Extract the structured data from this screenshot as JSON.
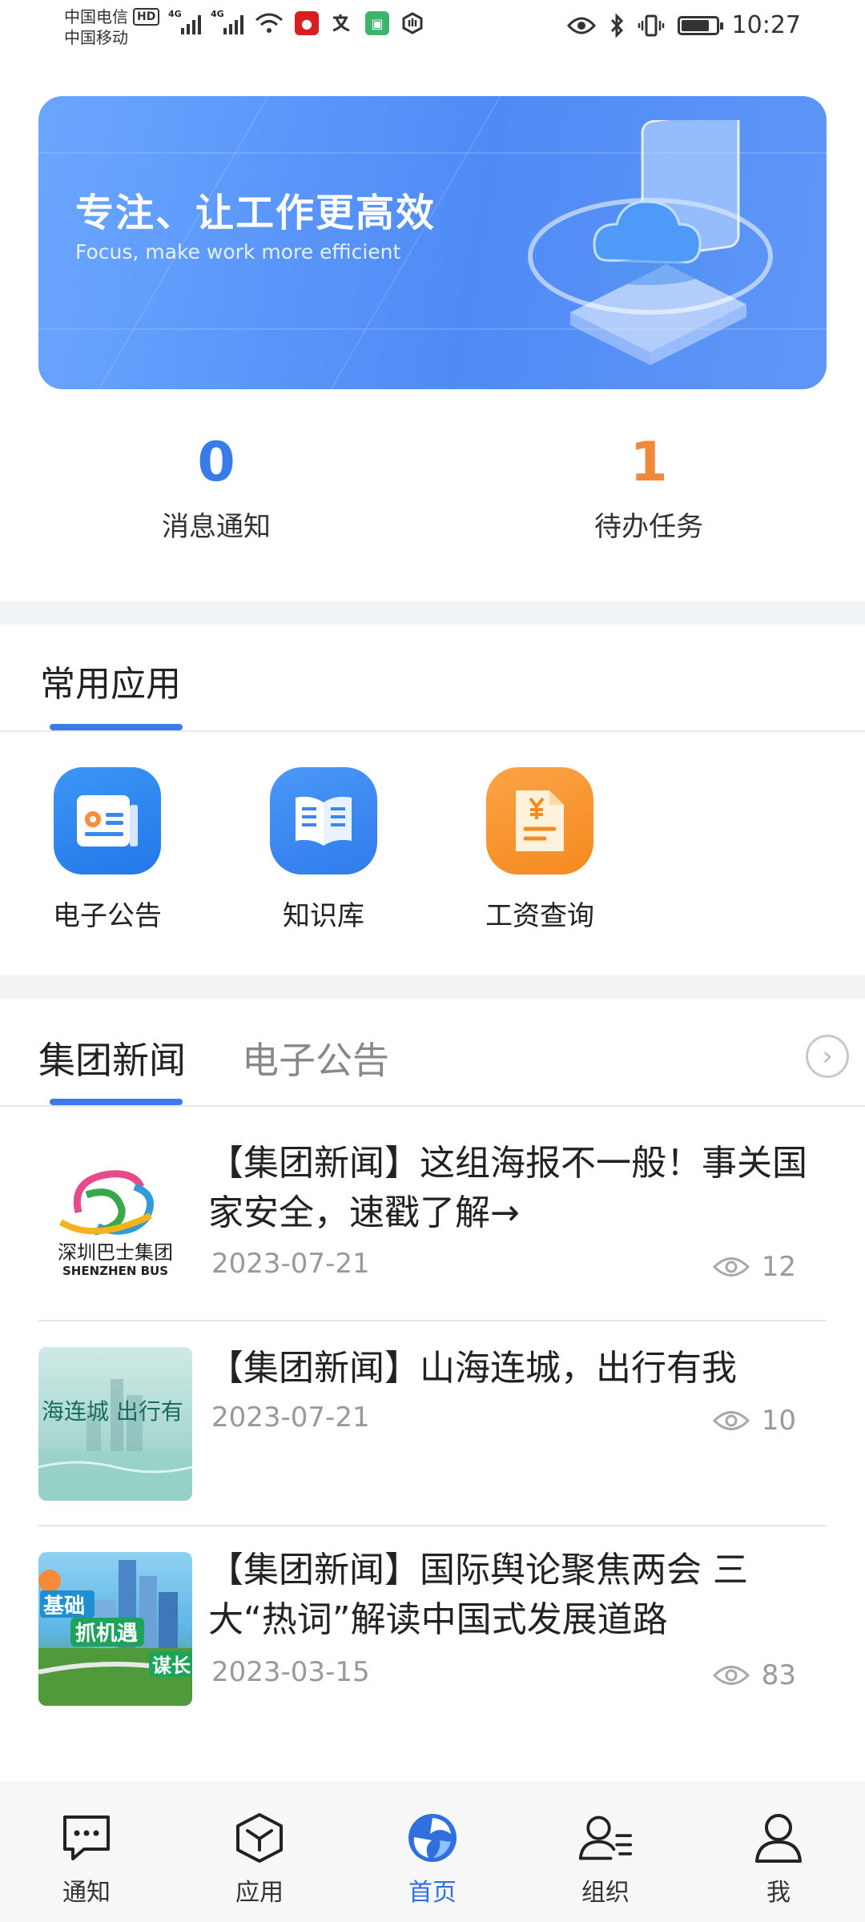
{
  "status_bar": {
    "carrier_1": "中国电信",
    "carrier_1_badge": "HD",
    "carrier_2": "中国移动",
    "network_tag": "4G",
    "time": "10:27"
  },
  "banner": {
    "title": "专注、让工作更高效",
    "subtitle": "Focus, make work more efficient"
  },
  "stats": [
    {
      "value": "0",
      "label": "消息通知",
      "color": "#3a7bea"
    },
    {
      "value": "1",
      "label": "待办任务",
      "color": "#f0893a"
    }
  ],
  "common_apps": {
    "title": "常用应用",
    "items": [
      {
        "label": "电子公告",
        "icon": "announcement-icon",
        "color": "#2f86f0"
      },
      {
        "label": "知识库",
        "icon": "book-icon",
        "color": "#3a86f2"
      },
      {
        "label": "工资查询",
        "icon": "salary-document-icon",
        "color": "#f79630"
      }
    ]
  },
  "news_tabs": {
    "tabs": [
      "集团新闻",
      "电子公告"
    ],
    "active": "集团新闻"
  },
  "news": [
    {
      "title": "【集团新闻】这组海报不一般！事关国家安全，速戳了解→",
      "date": "2023-07-21",
      "views": "12",
      "thumb_text": "深圳巴士集团",
      "thumb_subtext": "SHENZHEN BUS"
    },
    {
      "title": "【集团新闻】山海连城，出行有我",
      "date": "2023-07-21",
      "views": "10",
      "thumb_text": "海连城 出行有"
    },
    {
      "title": "【集团新闻】国际舆论聚焦两会 三大“热词”解读中国式发展道路",
      "date": "2023-03-15",
      "views": "83",
      "thumb_text_1": "基础",
      "thumb_text_2": "抓机遇",
      "thumb_text_3": "谋长"
    }
  ],
  "bottom_nav": [
    {
      "label": "通知",
      "icon": "chat-bubble-icon"
    },
    {
      "label": "应用",
      "icon": "cube-icon"
    },
    {
      "label": "首页",
      "icon": "home-logo-icon",
      "active": true
    },
    {
      "label": "组织",
      "icon": "organization-icon"
    },
    {
      "label": "我",
      "icon": "user-icon"
    }
  ]
}
